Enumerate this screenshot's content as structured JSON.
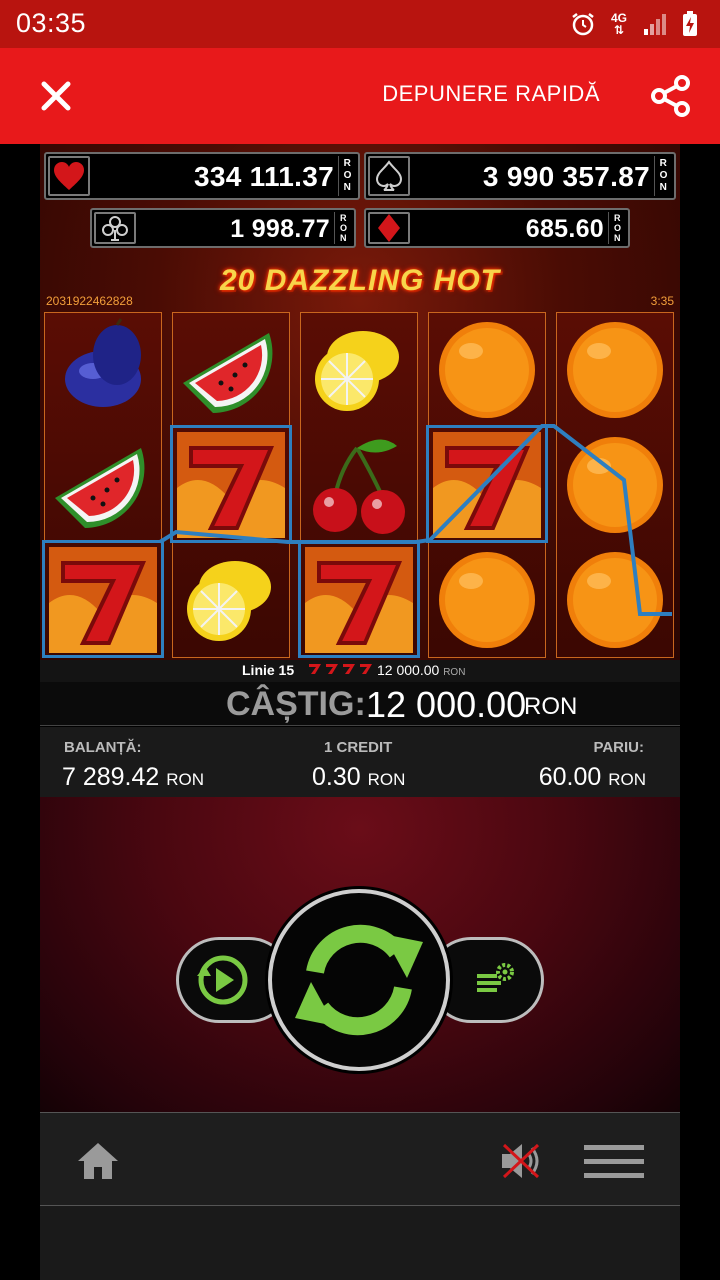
{
  "status_bar": {
    "time": "03:35",
    "network": "4G"
  },
  "topbar": {
    "deposit_label": "DEPUNERE RAPIDĂ"
  },
  "jackpots": {
    "hearts": {
      "value": "334 111.37",
      "currency": "RON"
    },
    "spades": {
      "value": "3 990 357.87",
      "currency": "RON"
    },
    "clubs": {
      "value": "1 998.77",
      "currency": "RON"
    },
    "diamonds": {
      "value": "685.60",
      "currency": "RON"
    }
  },
  "game": {
    "title": "20 DAZZLING HOT",
    "game_id": "2031922462828",
    "time": "3:35",
    "reels": [
      [
        "plum",
        "watermelon",
        "seven"
      ],
      [
        "watermelon",
        "seven",
        "lemon"
      ],
      [
        "lemon",
        "cherry",
        "seven"
      ],
      [
        "orange",
        "seven",
        "orange"
      ],
      [
        "orange",
        "orange",
        "orange"
      ]
    ],
    "payline_color": "#2e7fc0"
  },
  "win_line": {
    "label": "Linie 15",
    "amount": "12 000.00",
    "currency": "RON"
  },
  "win": {
    "label": "CÂȘTIG:",
    "amount": "12 000.00",
    "currency": "RON"
  },
  "stats": {
    "balance_label": "BALANȚĂ:",
    "balance_value": "7 289.42",
    "balance_currency": "RON",
    "credit_label": "1 CREDIT",
    "credit_value": "0.30",
    "credit_currency": "RON",
    "bet_label": "PARIU:",
    "bet_value": "60.00",
    "bet_currency": "RON"
  },
  "colors": {
    "accent": "#e8191b",
    "spin": "#7ac943"
  }
}
